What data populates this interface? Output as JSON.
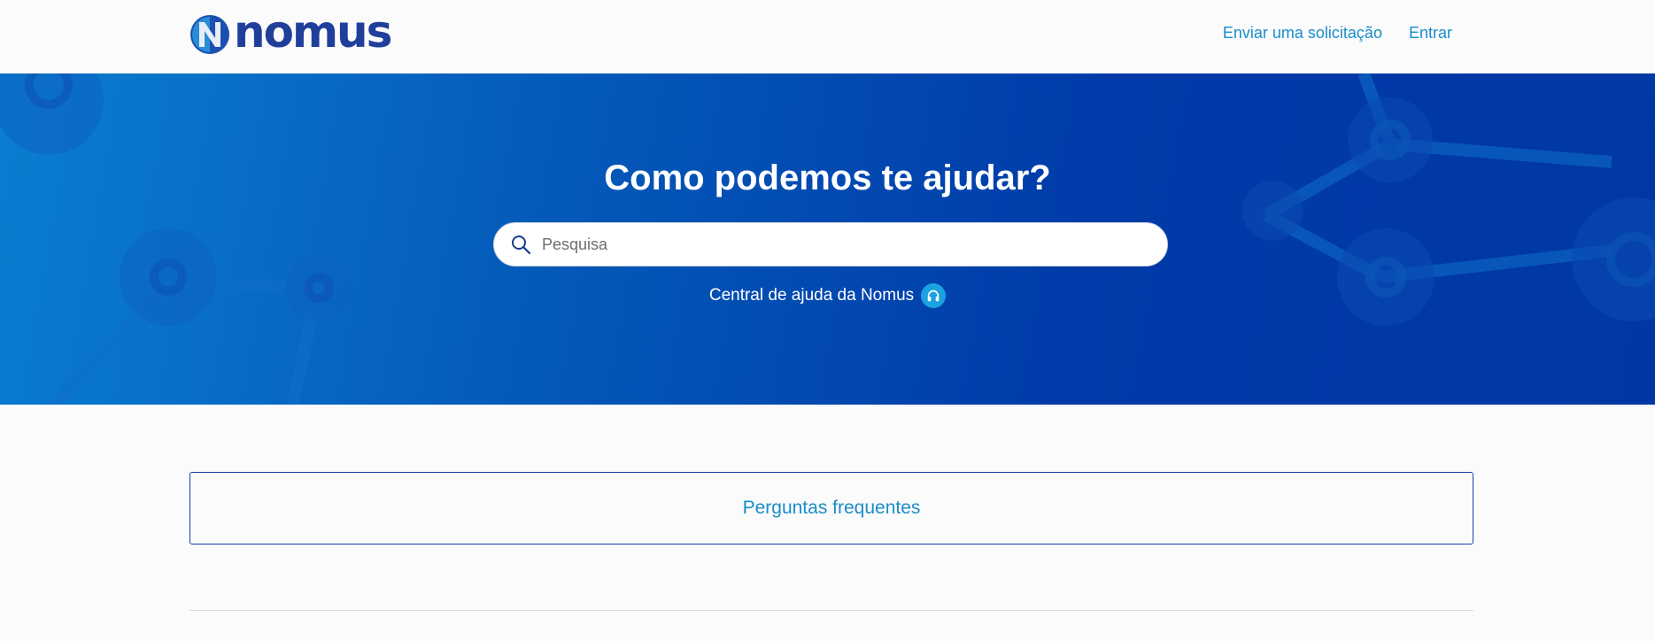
{
  "header": {
    "logo_text": "nomus",
    "nav": {
      "submit_request": "Enviar uma solicitação",
      "sign_in": "Entrar"
    }
  },
  "hero": {
    "title": "Como podemos te ajudar?",
    "search": {
      "placeholder": "Pesquisa",
      "icon": "search-icon"
    },
    "subtitle": "Central de ajuda da Nomus",
    "subtitle_icon": "headset-icon"
  },
  "main": {
    "faq_label": "Perguntas frequentes"
  },
  "colors": {
    "brand_blue": "#1f3f9a",
    "link_blue": "#1a8ec9",
    "hero_start": "#0a7ed0",
    "hero_end": "#0037a4",
    "accent_cyan": "#1ba2e0"
  }
}
